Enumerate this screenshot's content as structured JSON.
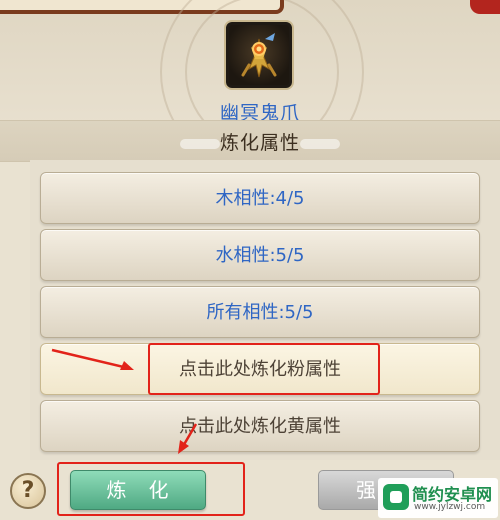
{
  "item": {
    "name": "幽冥鬼爪",
    "icon": "golden-claw-item-icon"
  },
  "section": {
    "title": "炼化属性"
  },
  "attributes": [
    {
      "label": "木相性:4/5"
    },
    {
      "label": "水相性:5/5"
    },
    {
      "label": "所有相性:5/5"
    }
  ],
  "refine_options": [
    {
      "label": "点击此处炼化粉属性"
    },
    {
      "label": "点击此处炼化黄属性"
    }
  ],
  "buttons": {
    "help_label": "?",
    "refine_label": "炼　化",
    "strengthen_label": "强"
  },
  "watermark": {
    "title": "简约安卓网",
    "url": "www.jylzwj.com",
    "icon": "android-logo-icon"
  },
  "colors": {
    "attribute_text": "#2f66c4",
    "annotation_red": "#e2231a",
    "refine_button": "#6cc59e"
  }
}
